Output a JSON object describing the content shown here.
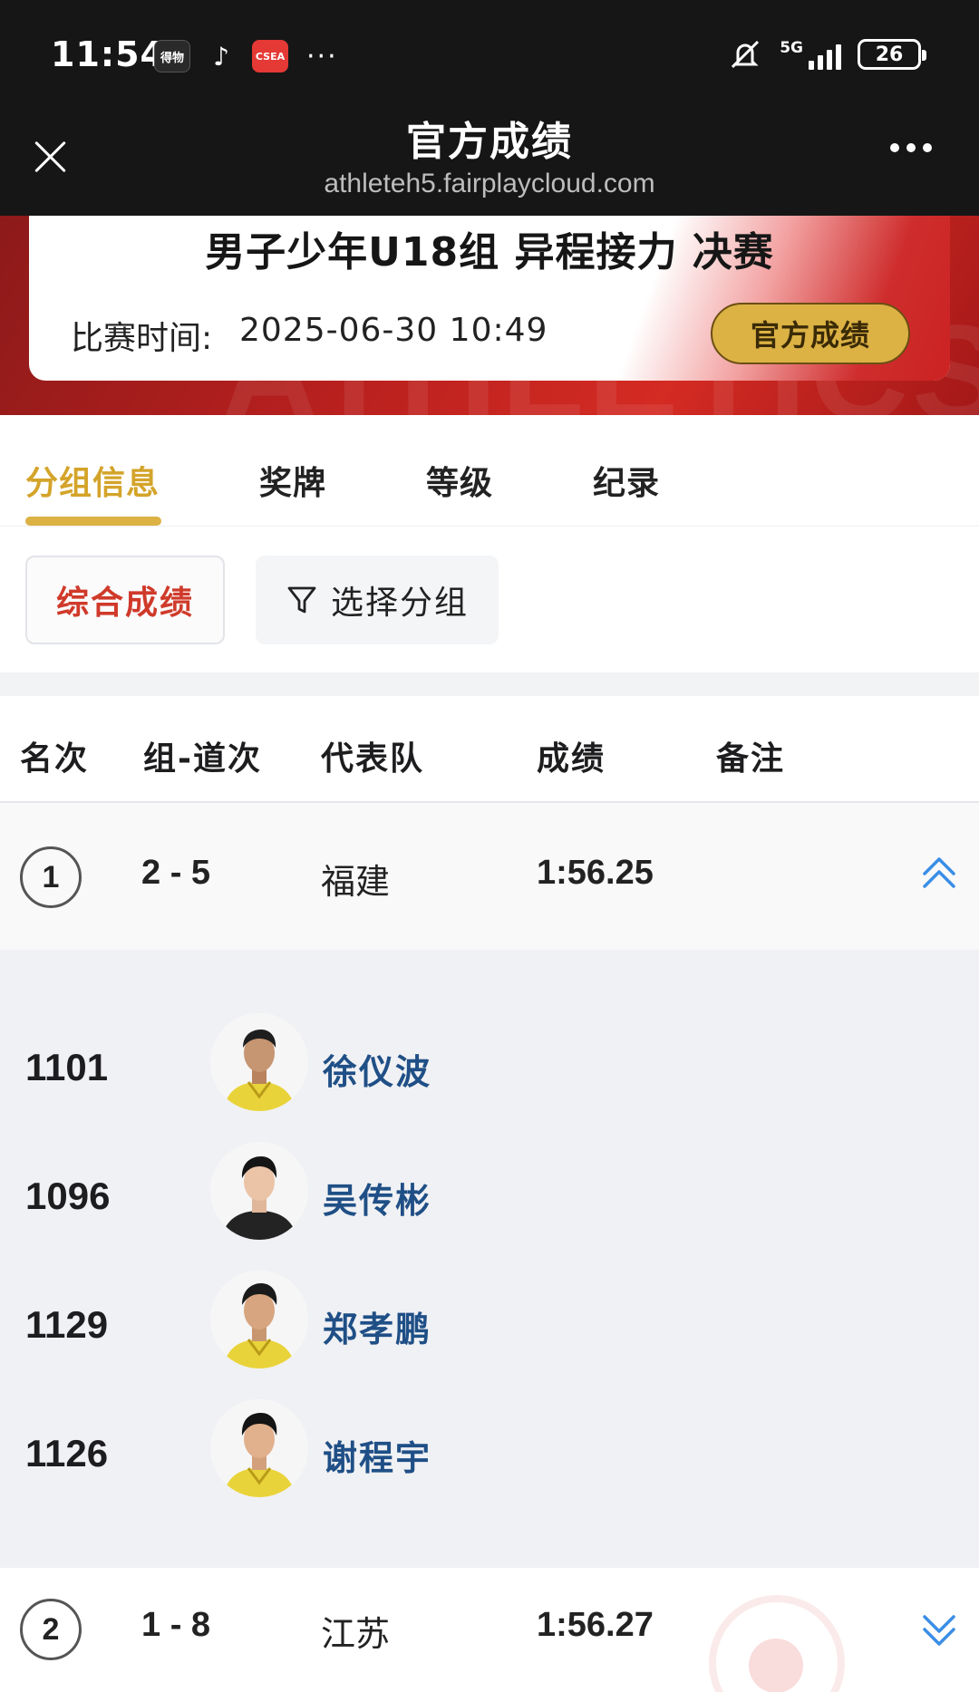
{
  "status_bar": {
    "time": "11:54",
    "apps": [
      "得物",
      "♪",
      "CSEA"
    ],
    "more": "···",
    "network": "5G",
    "battery": "26"
  },
  "nav": {
    "title": "官方成绩",
    "url": "athleteh5.fairplaycloud.com"
  },
  "event": {
    "title": "男子少年U18组 异程接力 决赛",
    "time_label": "比赛时间:",
    "time_value": "2025-06-30  10:49",
    "official_button": "官方成绩",
    "watermark": "ATHLETICS"
  },
  "tabs": [
    {
      "label": "分组信息",
      "active": true
    },
    {
      "label": "奖牌",
      "active": false
    },
    {
      "label": "等级",
      "active": false
    },
    {
      "label": "纪录",
      "active": false
    }
  ],
  "filters": {
    "combined": "综合成绩",
    "select_group": "选择分组"
  },
  "table": {
    "headers": [
      "名次",
      "组-道次",
      "代表队",
      "成绩",
      "备注"
    ],
    "rows": [
      {
        "rank": "1",
        "heat_lane": "2 - 5",
        "team": "福建",
        "result": "1:56.25",
        "note": "",
        "expanded": true,
        "members": [
          {
            "bib": "1101",
            "name": "徐仪波"
          },
          {
            "bib": "1096",
            "name": "吴传彬"
          },
          {
            "bib": "1129",
            "name": "郑孝鹏"
          },
          {
            "bib": "1126",
            "name": "谢程宇"
          }
        ]
      },
      {
        "rank": "2",
        "heat_lane": "1 - 8",
        "team": "江苏",
        "result": "1:56.27",
        "note": "",
        "expanded": false
      }
    ]
  },
  "colors": {
    "accent_gold": "#dcb245",
    "active_tab": "#d4a42a",
    "combined_red": "#d03a2a",
    "name_blue": "#1f4f86",
    "chevron_blue": "#3a8ee6",
    "hero_red": "#b8201e"
  }
}
